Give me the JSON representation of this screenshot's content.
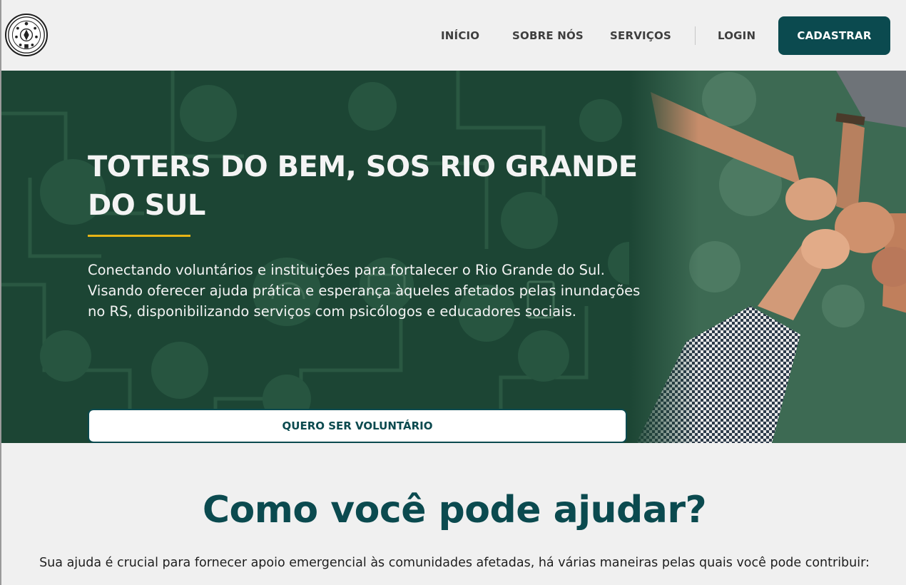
{
  "header": {
    "logo_icon": "emblem-seal-icon",
    "nav": [
      {
        "label": "INÍCIO"
      },
      {
        "label": "SOBRE NÓS"
      },
      {
        "label": "SERVIÇOS"
      },
      {
        "label": "LOGIN"
      }
    ],
    "cta_label": "CADASTRAR"
  },
  "hero": {
    "title": "TOTERS DO BEM, SOS RIO GRANDE DO SUL",
    "description": "Conectando voluntários e instituições para fortalecer o Rio Grande do Sul. Visando oferecer ajuda prática e esperança àqueles afetados pelas inundações no RS, disponibilizando serviços com psicólogos e educadores sociais.",
    "button_label": "QUERO SER VOLUNTÁRIO",
    "image_icon": "team-hands-photo"
  },
  "help": {
    "title": "Como você pode ajudar?",
    "text": "Sua ajuda é crucial para fornecer apoio emergencial às comunidades afetadas, há várias maneiras pelas quais você pode contribuir:"
  },
  "colors": {
    "brand": "#0b4a4f",
    "hero_bg": "#1b4332",
    "accent": "#e7b416",
    "page_bg": "#f0f0f0"
  }
}
